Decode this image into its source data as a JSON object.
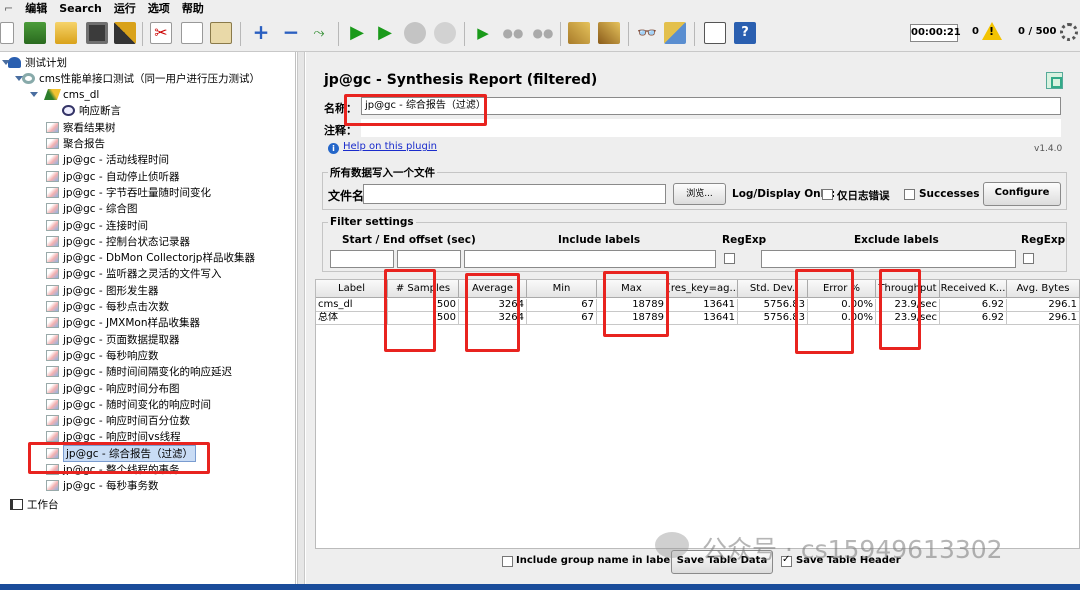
{
  "menu": [
    "编辑",
    "Search",
    "运行",
    "选项",
    "帮助"
  ],
  "toolbar": {
    "timer": "00:00:21",
    "warnings": "0",
    "threads": "0 / 500",
    "icons": [
      "new-icon",
      "templates-icon",
      "open-icon",
      "save-icon",
      "save-as-icon",
      "cut-icon",
      "copy-icon",
      "paste-icon",
      "expand-icon",
      "collapse-icon",
      "toggle-icon",
      "start-icon",
      "start-no-pause-icon",
      "stop-icon",
      "shutdown-icon",
      "remote-start-icon",
      "remote-stop-icon",
      "remote-shutdown-icon",
      "clear-icon",
      "clear-all-icon",
      "search-icon",
      "reset-search-icon",
      "function-helper-icon",
      "help-icon"
    ]
  },
  "tree": {
    "items": [
      {
        "label": "测试计划",
        "icon": "plan"
      },
      {
        "label": "cms性能单接口测试（同一用户进行压力测试）",
        "icon": "group"
      },
      {
        "label": "cms_dl",
        "icon": "sampler"
      },
      {
        "label": "响应断言",
        "icon": "assert"
      },
      {
        "label": "察看结果树",
        "icon": "listener"
      },
      {
        "label": "聚合报告",
        "icon": "listener"
      },
      {
        "label": "jp@gc - 活动线程时间",
        "icon": "listener"
      },
      {
        "label": "jp@gc - 自动停止侦听器",
        "icon": "listener"
      },
      {
        "label": "jp@gc - 字节吞吐量随时间变化",
        "icon": "listener"
      },
      {
        "label": "jp@gc - 综合图",
        "icon": "listener"
      },
      {
        "label": "jp@gc - 连接时间",
        "icon": "listener"
      },
      {
        "label": "jp@gc - 控制台状态记录器",
        "icon": "listener"
      },
      {
        "label": "jp@gc - DbMon Collectorjp样品收集器",
        "icon": "listener"
      },
      {
        "label": "jp@gc - 监听器之灵活的文件写入",
        "icon": "listener"
      },
      {
        "label": "jp@gc - 图形发生器",
        "icon": "listener"
      },
      {
        "label": "jp@gc - 每秒点击次数",
        "icon": "listener"
      },
      {
        "label": "jp@gc - JMXMon样品收集器",
        "icon": "listener"
      },
      {
        "label": "jp@gc - 页面数据提取器",
        "icon": "listener"
      },
      {
        "label": "jp@gc - 每秒响应数",
        "icon": "listener"
      },
      {
        "label": "jp@gc - 随时间间隔变化的响应延迟",
        "icon": "listener"
      },
      {
        "label": "jp@gc - 响应时间分布图",
        "icon": "listener"
      },
      {
        "label": "jp@gc - 随时间变化的响应时间",
        "icon": "listener"
      },
      {
        "label": "jp@gc - 响应时间百分位数",
        "icon": "listener"
      },
      {
        "label": "jp@gc - 响应时间vs线程",
        "icon": "listener"
      },
      {
        "label": "jp@gc - 综合报告（过滤）",
        "icon": "listener"
      },
      {
        "label": "jp@gc - 整个线程的事务",
        "icon": "listener"
      },
      {
        "label": "jp@gc - 每秒事务数",
        "icon": "listener"
      },
      {
        "label": "工作台",
        "icon": "bench"
      }
    ]
  },
  "panel": {
    "title": "jp@gc - Synthesis Report (filtered)",
    "name_label": "名称：",
    "name_value": "jp@gc - 综合报告（过滤）",
    "comment_label": "注释：",
    "comment_value": "",
    "help_link": "Help on this plugin",
    "version": "v1.4.0",
    "write_group_title": "所有数据写入一个文件",
    "filename_label": "文件名",
    "filename_value": "",
    "browse_button": "浏览...",
    "log_display_label": "Log/Display Only:",
    "errors_only_label": "仅日志错误",
    "successes_label": "Successes",
    "configure_button": "Configure",
    "filter_group_title": "Filter settings",
    "offset_label": "Start / End offset (sec)",
    "include_labels": "Include labels",
    "regexp_label_1": "RegExp",
    "exclude_labels": "Exclude labels",
    "regexp_label_2": "RegExp",
    "columns": [
      "Label",
      "# Samples",
      "Average",
      "Min",
      "Max",
      "[res_key=ag...",
      "Std. Dev.",
      "Error %",
      "Throughput",
      "Received K...",
      "Avg. Bytes"
    ],
    "rows": [
      [
        "cms_dl",
        "500",
        "3264",
        "67",
        "18789",
        "13641",
        "5756.83",
        "0.00%",
        "23.9/sec",
        "6.92",
        "296.1"
      ],
      [
        "总体",
        "500",
        "3264",
        "67",
        "18789",
        "13641",
        "5756.83",
        "0.00%",
        "23.9/sec",
        "6.92",
        "296.1"
      ]
    ],
    "include_group_label": "Include group name in label?",
    "save_data_button": "Save Table Data",
    "save_header_label": "Save Table Header"
  },
  "watermark": "公众号 · cs15949613302",
  "colors": {
    "highlight_box": "#e8231f",
    "link": "#1a2ccc",
    "selected_tree": "#c9dcf5"
  }
}
